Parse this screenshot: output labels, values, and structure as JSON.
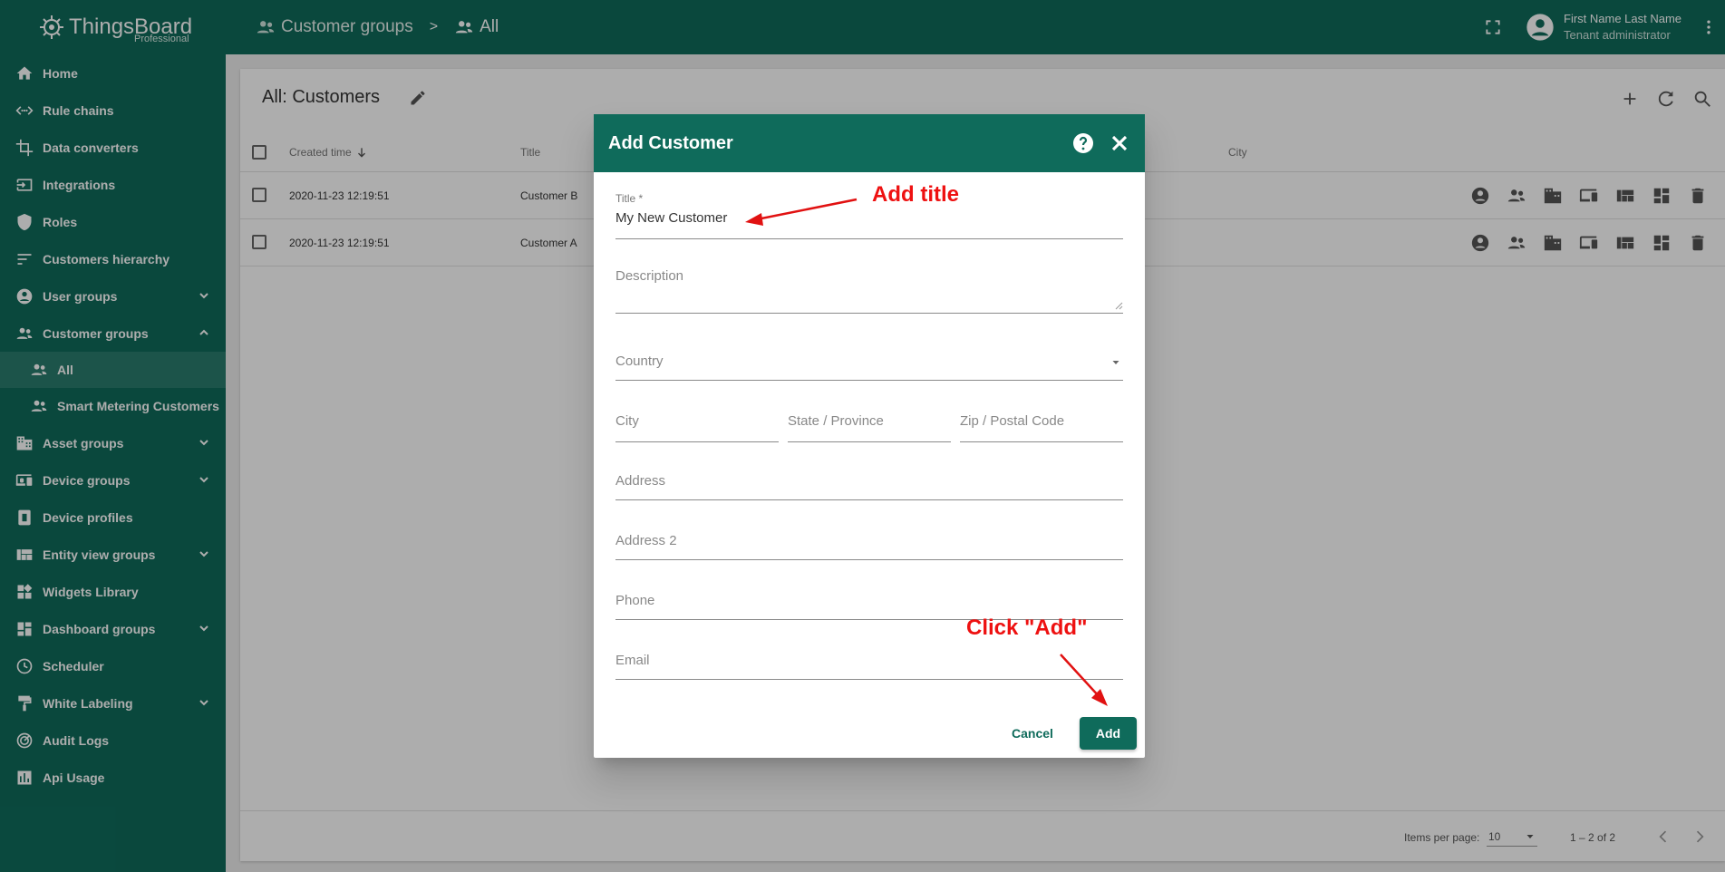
{
  "app": {
    "logo_text": "ThingsBoard",
    "logo_sub": "Professional",
    "accent": "#0f6b5b"
  },
  "sidebar": {
    "items": [
      {
        "label": "Home",
        "icon": "home-icon"
      },
      {
        "label": "Rule chains",
        "icon": "rule-chains-icon"
      },
      {
        "label": "Data converters",
        "icon": "crop-icon"
      },
      {
        "label": "Integrations",
        "icon": "input-icon"
      },
      {
        "label": "Roles",
        "icon": "shield-icon"
      },
      {
        "label": "Customers hierarchy",
        "icon": "sort-icon"
      },
      {
        "label": "User groups",
        "icon": "account-circle-icon"
      },
      {
        "label": "Customer groups",
        "icon": "supervisor-account-icon"
      },
      {
        "label": "All",
        "icon": "supervisor-account-icon"
      },
      {
        "label": "Smart Metering Customers",
        "icon": "supervisor-account-icon"
      },
      {
        "label": "Asset groups",
        "icon": "domain-icon"
      },
      {
        "label": "Device groups",
        "icon": "devices-other-icon"
      },
      {
        "label": "Device profiles",
        "icon": "device-profile-icon"
      },
      {
        "label": "Entity view groups",
        "icon": "view-quilt-icon"
      },
      {
        "label": "Widgets Library",
        "icon": "widgets-icon"
      },
      {
        "label": "Dashboard groups",
        "icon": "dashboard-icon"
      },
      {
        "label": "Scheduler",
        "icon": "schedule-icon"
      },
      {
        "label": "White Labeling",
        "icon": "format-paint-icon"
      },
      {
        "label": "Audit Logs",
        "icon": "track-changes-icon"
      },
      {
        "label": "Api Usage",
        "icon": "insert-chart-icon"
      }
    ]
  },
  "topbar": {
    "crumb1": "Customer groups",
    "crumb_sep": ">",
    "crumb2": "All",
    "user_name": "First Name Last Name",
    "user_role": "Tenant administrator"
  },
  "main": {
    "title": "All: Customers",
    "columns": {
      "created": "Created time",
      "title": "Title",
      "city": "City"
    },
    "rows": [
      {
        "created": "2020-11-23 12:19:51",
        "title": "Customer B"
      },
      {
        "created": "2020-11-23 12:19:51",
        "title": "Customer A"
      }
    ],
    "footer": {
      "items_per_page_label": "Items per page:",
      "items_per_page": "10",
      "range": "1 – 2 of 2"
    }
  },
  "dialog": {
    "title": "Add Customer",
    "title_label": "Title *",
    "title_value": "My New Customer",
    "description_placeholder": "Description",
    "country_placeholder": "Country",
    "city_placeholder": "City",
    "state_placeholder": "State / Province",
    "zip_placeholder": "Zip / Postal Code",
    "address_placeholder": "Address",
    "address2_placeholder": "Address 2",
    "phone_placeholder": "Phone",
    "email_placeholder": "Email",
    "cancel_label": "Cancel",
    "add_label": "Add"
  },
  "annotations": {
    "add_title": "Add title",
    "click_add": "Click \"Add\"",
    "color": "#e11111"
  }
}
